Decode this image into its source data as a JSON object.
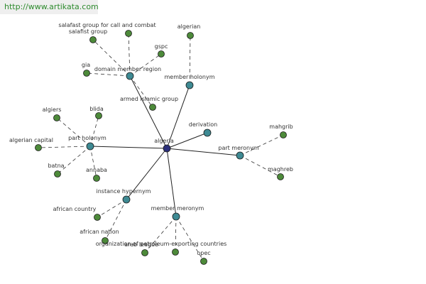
{
  "watermark_url": "http://www.artikata.com",
  "colors": {
    "central_node": "#2b2f7a",
    "relation_node": "#3e8a93",
    "leaf_node": "#4d8a3a",
    "solid_edge": "#222222",
    "dashed_edge": "#333333"
  },
  "nodes": [
    {
      "id": "algeria",
      "label": "algeria",
      "kind": "central"
    },
    {
      "id": "domain-member-region",
      "label": "domain member region",
      "kind": "relation"
    },
    {
      "id": "member-holonym",
      "label": "member holonym",
      "kind": "relation"
    },
    {
      "id": "derivation",
      "label": "derivation",
      "kind": "relation"
    },
    {
      "id": "part-meronym",
      "label": "part meronym",
      "kind": "relation"
    },
    {
      "id": "part-holonym",
      "label": "part holonym",
      "kind": "relation"
    },
    {
      "id": "instance-hypernym",
      "label": "instance hypernym",
      "kind": "relation"
    },
    {
      "id": "member-meronym",
      "label": "member meronym",
      "kind": "relation"
    },
    {
      "id": "salafast",
      "label": "salafast group for call and combat",
      "kind": "leaf"
    },
    {
      "id": "salafist",
      "label": "salafist group",
      "kind": "leaf"
    },
    {
      "id": "gspc",
      "label": "gspc",
      "kind": "leaf"
    },
    {
      "id": "gia",
      "label": "gia",
      "kind": "leaf"
    },
    {
      "id": "armed-islamic-group",
      "label": "armed islamic group",
      "kind": "leaf"
    },
    {
      "id": "algerian",
      "label": "algerian",
      "kind": "leaf"
    },
    {
      "id": "mahgrib",
      "label": "mahgrib",
      "kind": "leaf"
    },
    {
      "id": "maghreb",
      "label": "maghreb",
      "kind": "leaf"
    },
    {
      "id": "algiers",
      "label": "algiers",
      "kind": "leaf"
    },
    {
      "id": "blida",
      "label": "blida",
      "kind": "leaf"
    },
    {
      "id": "algerian-capital",
      "label": "algerian capital",
      "kind": "leaf"
    },
    {
      "id": "batna",
      "label": "batna",
      "kind": "leaf"
    },
    {
      "id": "annaba",
      "label": "annaba",
      "kind": "leaf"
    },
    {
      "id": "african-country",
      "label": "african country",
      "kind": "leaf"
    },
    {
      "id": "african-nation",
      "label": "african nation",
      "kind": "leaf"
    },
    {
      "id": "opec-full",
      "label": "organization of petroleum-exporting countries",
      "kind": "leaf"
    },
    {
      "id": "arab-league",
      "label": "arab league",
      "kind": "leaf"
    },
    {
      "id": "opec",
      "label": "opec",
      "kind": "leaf"
    }
  ],
  "edges": [
    {
      "from": "algeria",
      "to": "domain-member-region",
      "style": "solid"
    },
    {
      "from": "algeria",
      "to": "member-holonym",
      "style": "solid"
    },
    {
      "from": "algeria",
      "to": "derivation",
      "style": "solid"
    },
    {
      "from": "algeria",
      "to": "part-meronym",
      "style": "solid"
    },
    {
      "from": "algeria",
      "to": "part-holonym",
      "style": "solid"
    },
    {
      "from": "algeria",
      "to": "instance-hypernym",
      "style": "solid"
    },
    {
      "from": "algeria",
      "to": "member-meronym",
      "style": "solid"
    },
    {
      "from": "domain-member-region",
      "to": "salafast",
      "style": "dashed"
    },
    {
      "from": "domain-member-region",
      "to": "salafist",
      "style": "dashed"
    },
    {
      "from": "domain-member-region",
      "to": "gspc",
      "style": "dashed"
    },
    {
      "from": "domain-member-region",
      "to": "gia",
      "style": "dashed"
    },
    {
      "from": "domain-member-region",
      "to": "armed-islamic-group",
      "style": "dashed"
    },
    {
      "from": "member-holonym",
      "to": "algerian",
      "style": "dashed"
    },
    {
      "from": "part-meronym",
      "to": "mahgrib",
      "style": "dashed"
    },
    {
      "from": "part-meronym",
      "to": "maghreb",
      "style": "dashed"
    },
    {
      "from": "part-holonym",
      "to": "algiers",
      "style": "dashed"
    },
    {
      "from": "part-holonym",
      "to": "blida",
      "style": "dashed"
    },
    {
      "from": "part-holonym",
      "to": "algerian-capital",
      "style": "dashed"
    },
    {
      "from": "part-holonym",
      "to": "batna",
      "style": "dashed"
    },
    {
      "from": "part-holonym",
      "to": "annaba",
      "style": "dashed"
    },
    {
      "from": "instance-hypernym",
      "to": "african-country",
      "style": "dashed"
    },
    {
      "from": "instance-hypernym",
      "to": "african-nation",
      "style": "dashed"
    },
    {
      "from": "member-meronym",
      "to": "opec-full",
      "style": "dashed"
    },
    {
      "from": "member-meronym",
      "to": "arab-league",
      "style": "dashed"
    },
    {
      "from": "member-meronym",
      "to": "opec",
      "style": "dashed"
    }
  ]
}
